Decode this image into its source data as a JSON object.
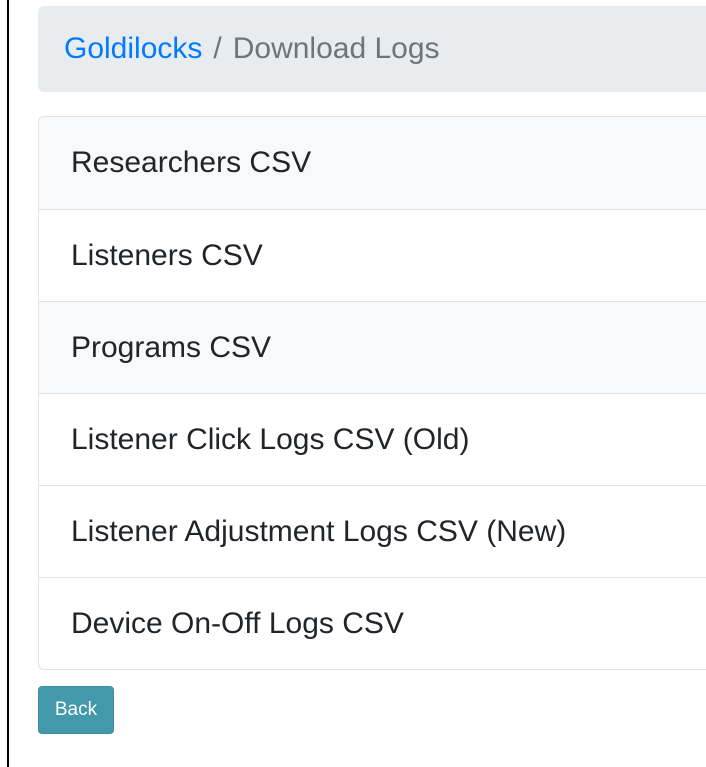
{
  "breadcrumb": {
    "home": "Goldilocks",
    "separator": "/",
    "current": "Download Logs"
  },
  "downloads": {
    "items": [
      {
        "label": "Researchers CSV"
      },
      {
        "label": "Listeners CSV"
      },
      {
        "label": "Programs CSV"
      },
      {
        "label": "Listener Click Logs CSV (Old)"
      },
      {
        "label": "Listener Adjustment Logs CSV (New)"
      },
      {
        "label": "Device On-Off Logs CSV"
      }
    ]
  },
  "actions": {
    "back_label": "Back"
  },
  "colors": {
    "link": "#007bff",
    "breadcrumb_bg": "#e9ecef",
    "button": "#4399aa"
  }
}
